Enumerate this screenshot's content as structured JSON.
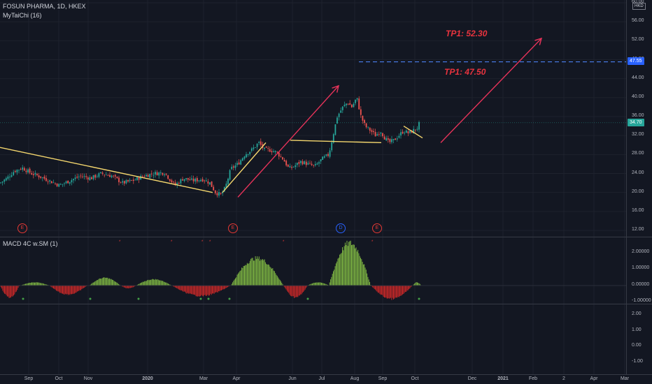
{
  "header": {
    "symbol_line": "FOSUN PHARMA, 1D, HKEX",
    "indicator_1": "MyTaiChi (16)",
    "indicator_2": "MACD 4C w.SM (1)",
    "currency": "HKD"
  },
  "price_axis": {
    "ticks": [
      "60.00",
      "56.00",
      "52.00",
      "48.00",
      "44.00",
      "40.00",
      "36.00",
      "32.00",
      "28.00",
      "24.00",
      "20.00",
      "16.00",
      "12.00"
    ],
    "last_price": "34.70",
    "last_price_color": "#26a69a",
    "level_price": "47.55",
    "level_color": "#2962ff"
  },
  "macd_axis": {
    "ticks": [
      "2.00000",
      "1.00000",
      "0.00000",
      "-1.00000"
    ]
  },
  "lower_axis": {
    "ticks": [
      "2.00",
      "1.00",
      "0.00",
      "-1.00"
    ]
  },
  "time_axis": {
    "ticks": [
      "Sep",
      "Oct",
      "Nov",
      "2020",
      "Mar",
      "Apr",
      "Jun",
      "Jul",
      "Aug",
      "Sep",
      "Oct",
      "Dec",
      "2021",
      "Feb",
      "2",
      "Apr",
      "Mar"
    ]
  },
  "annotations": {
    "tp1_upper": "TP1: 52.30",
    "tp1_lower": "TP1: 47.50",
    "tp_color": "#e8333e"
  },
  "events": [
    {
      "letter": "E",
      "type": "earnings"
    },
    {
      "letter": "E",
      "type": "earnings"
    },
    {
      "letter": "D",
      "type": "dividend"
    },
    {
      "letter": "E",
      "type": "earnings"
    }
  ],
  "colors": {
    "up": "#26a69a",
    "down": "#ef5350",
    "macd_up": "#7cb342",
    "macd_down": "#c62828",
    "trendline": "#f5d76e",
    "arrow": "#e8335a"
  },
  "chart_data": {
    "type": "candlestick",
    "price_axis_range": [
      12,
      60
    ],
    "price_path": [
      [
        0,
        22.0
      ],
      [
        10,
        23.0
      ],
      [
        20,
        24.5
      ],
      [
        32,
        25.2
      ],
      [
        45,
        24.0
      ],
      [
        55,
        23.5
      ],
      [
        70,
        22.5
      ],
      [
        85,
        21.5
      ],
      [
        100,
        22.5
      ],
      [
        115,
        23.5
      ],
      [
        130,
        23.0
      ],
      [
        145,
        24.0
      ],
      [
        160,
        23.5
      ],
      [
        175,
        22.0
      ],
      [
        190,
        22.5
      ],
      [
        205,
        23.5
      ],
      [
        220,
        24.0
      ],
      [
        235,
        24.2
      ],
      [
        250,
        21.5
      ],
      [
        262,
        23.0
      ],
      [
        275,
        22.5
      ],
      [
        290,
        22.8
      ],
      [
        300,
        22.0
      ],
      [
        308,
        20.0
      ],
      [
        316,
        19.5
      ],
      [
        322,
        21.0
      ],
      [
        330,
        25.0
      ],
      [
        340,
        26.0
      ],
      [
        350,
        28.0
      ],
      [
        360,
        29.0
      ],
      [
        370,
        30.5
      ],
      [
        378,
        29.0
      ],
      [
        385,
        29.0
      ],
      [
        395,
        28.5
      ],
      [
        405,
        27.0
      ],
      [
        413,
        25.0
      ],
      [
        420,
        25.5
      ],
      [
        430,
        26.5
      ],
      [
        440,
        26.0
      ],
      [
        450,
        25.5
      ],
      [
        460,
        27.0
      ],
      [
        470,
        28.0
      ],
      [
        476,
        32.0
      ],
      [
        482,
        36.0
      ],
      [
        490,
        38.0
      ],
      [
        497,
        39.0
      ],
      [
        503,
        38.0
      ],
      [
        510,
        40.0
      ],
      [
        516,
        36.0
      ],
      [
        522,
        34.0
      ],
      [
        530,
        33.0
      ],
      [
        537,
        32.0
      ],
      [
        544,
        33.0
      ],
      [
        550,
        31.5
      ],
      [
        556,
        30.5
      ],
      [
        563,
        31.0
      ],
      [
        570,
        32.0
      ],
      [
        577,
        33.0
      ],
      [
        584,
        32.5
      ],
      [
        590,
        33.0
      ],
      [
        596,
        33.5
      ],
      [
        600,
        34.7
      ]
    ],
    "trendlines": [
      [
        [
          0,
          29.5
        ],
        [
          304,
          20.0
        ]
      ],
      [
        [
          318,
          20.0
        ],
        [
          380,
          30.5
        ]
      ],
      [
        [
          415,
          31.0
        ],
        [
          545,
          30.5
        ]
      ],
      [
        [
          577,
          34.0
        ],
        [
          604,
          31.5
        ]
      ]
    ],
    "arrows": [
      [
        [
          340,
          19.0
        ],
        [
          484,
          42.5
        ]
      ],
      [
        [
          630,
          30.5
        ],
        [
          774,
          52.5
        ]
      ]
    ],
    "level_line": 47.55,
    "macd_axis_range": [
      -1.0,
      2.3
    ],
    "lower_axis_range": [
      -1.5,
      2.5
    ]
  }
}
